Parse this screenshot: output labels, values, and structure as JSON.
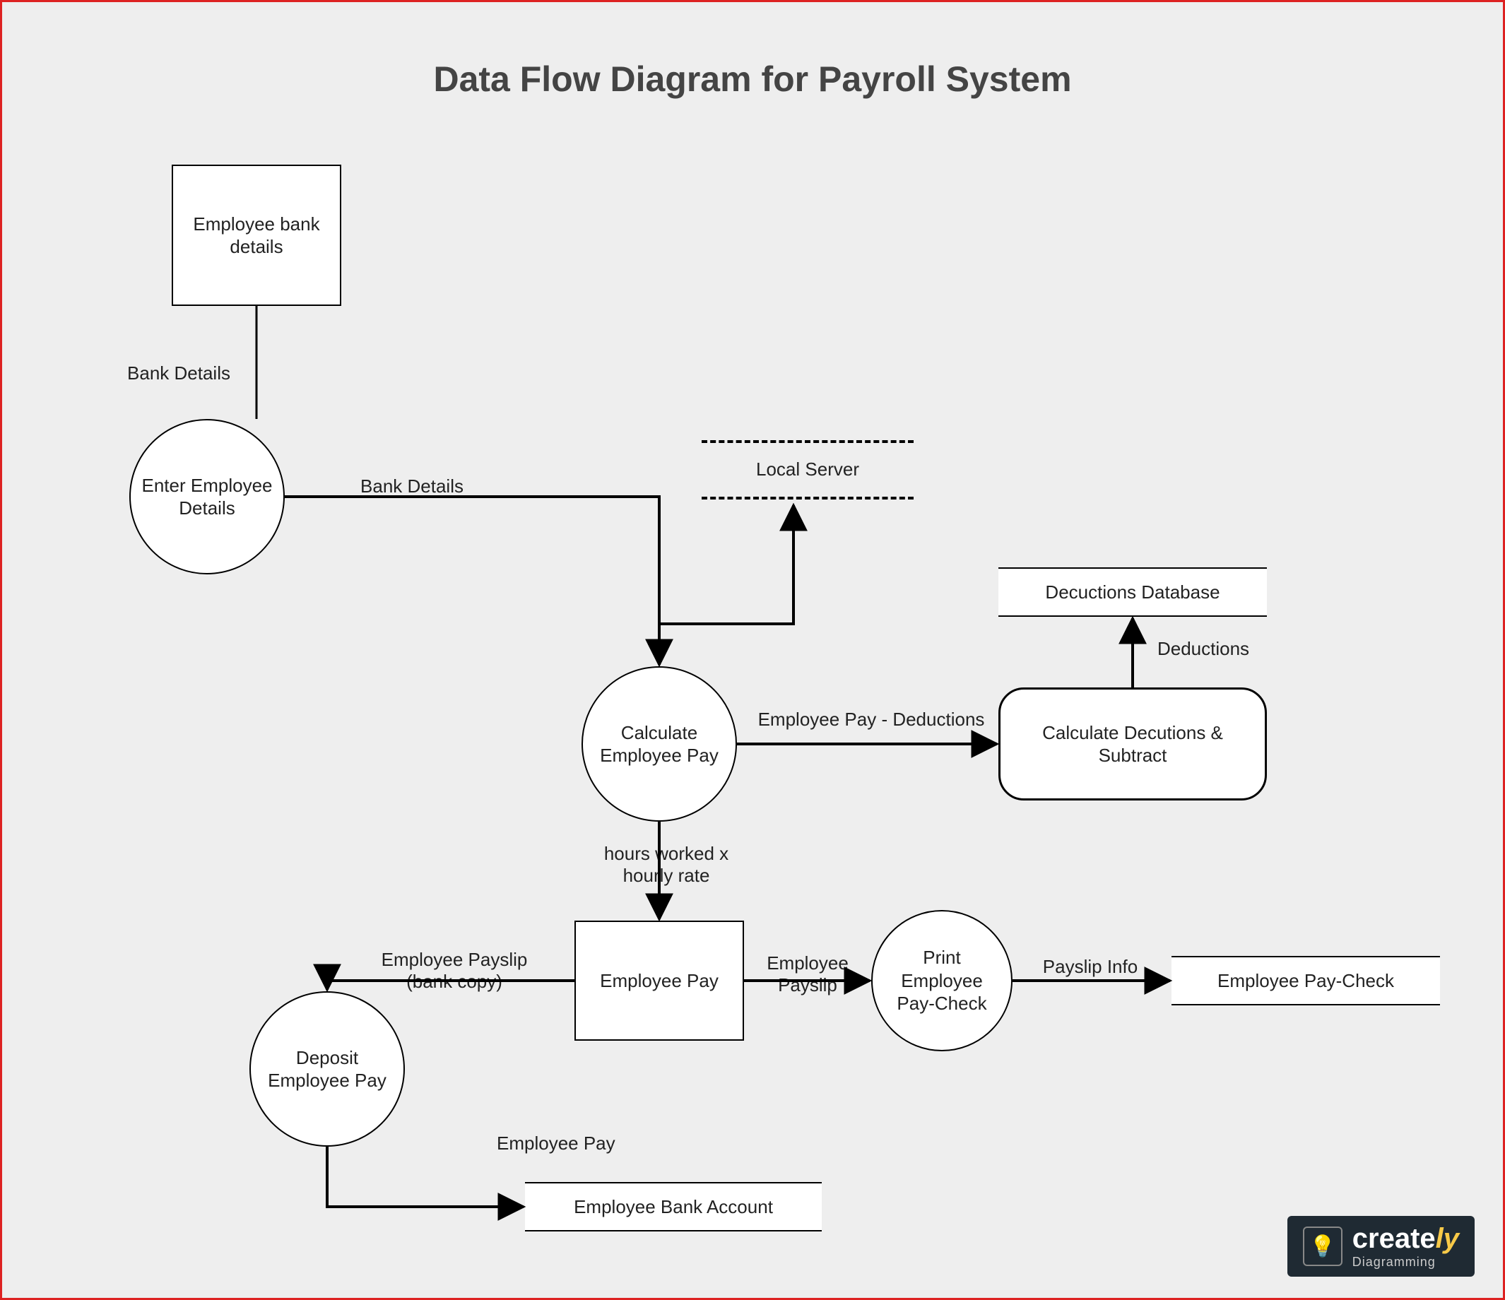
{
  "title": "Data Flow Diagram for Payroll System",
  "nodes": {
    "emp_bank_details": "Employee bank details",
    "enter_emp_details": "Enter Employee Details",
    "local_server": "Local Server",
    "calc_emp_pay": "Calculate Employee Pay",
    "deductions_db": "Decuctions Database",
    "calc_deductions": "Calculate Decutions & Subtract",
    "employee_pay": "Employee Pay",
    "print_paycheck": "Print Employee Pay-Check",
    "emp_paycheck": "Employee Pay-Check",
    "deposit_pay": "Deposit Employee Pay",
    "emp_bank_account": "Employee Bank Account"
  },
  "flows": {
    "bank_details_1": "Bank Details",
    "bank_details_2": "Bank Details",
    "emp_pay_minus_ded": "Employee Pay - Deductions",
    "deductions": "Deductions",
    "hours_rate": "hours worked x hourly rate",
    "emp_payslip": "Employee Payslip",
    "payslip_bank_copy": "Employee Payslip (bank copy)",
    "payslip_info": "Payslip Info",
    "employee_pay_flow": "Employee Pay"
  },
  "branding": {
    "name": "create",
    "suffix": "ly",
    "tag": "Diagramming"
  }
}
